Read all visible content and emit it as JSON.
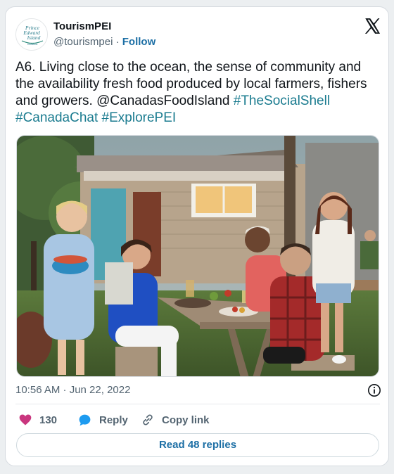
{
  "account": {
    "display_name": "TourismPEI",
    "handle": "@tourismpei",
    "separator": "·",
    "follow_label": "Follow",
    "avatar_logo_lines": [
      "Prince",
      "Edward",
      "Island"
    ],
    "avatar_logo_sub": "CANADA"
  },
  "tweet": {
    "text": "A6. Living close to the ocean, the sense of community and the availability fresh food produced by local farmers, fishers and growers. @CanadasFoodIsland",
    "hashtags": "#TheSocialShell #CanadaChat #ExplorePEI"
  },
  "media": {
    "description_icon": "photo"
  },
  "meta": {
    "timestamp": "10:56 AM · Jun 22, 2022"
  },
  "actions": {
    "like_count": "130",
    "reply_label": "Reply",
    "copy_link_label": "Copy link"
  },
  "footer": {
    "read_replies_label": "Read 48 replies"
  },
  "colors": {
    "link": "#1d6fa5",
    "hashtag": "#1a7b8f",
    "heart": "#c9367e",
    "reply_bubble": "#1d9bf0",
    "muted": "#536471"
  }
}
